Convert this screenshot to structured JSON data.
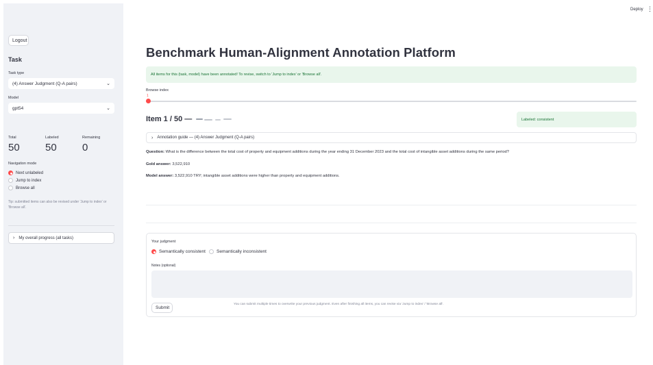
{
  "topbar": {
    "deploy_label": "Deploy",
    "menu_glyph": "⋮"
  },
  "sidebar": {
    "logout_label": "Logout",
    "task_heading": "Task",
    "task_type_label": "Task type",
    "task_type_value": "(4) Answer Judgment (Q-A pairs)",
    "model_label": "Model",
    "model_value": "gpt54",
    "metrics": [
      {
        "label": "Total",
        "value": "50"
      },
      {
        "label": "Labeled",
        "value": "50"
      },
      {
        "label": "Remaining",
        "value": "0"
      }
    ],
    "navigation_label": "Navigation mode",
    "navigation_options": [
      "Next unlabeled",
      "Jump to index",
      "Browse all"
    ],
    "navigation_selected": "Next unlabeled",
    "tip": "Tip: submitted items can also be revised under 'Jump to index' or 'Browse all'.",
    "progress_expander": "My overall progress (all tasks)"
  },
  "main": {
    "title": "Benchmark Human-Alignment Annotation Platform",
    "success_message": "All items for this (task, model) have been annotated! To revise, switch to 'Jump to index' or 'Browse all'.",
    "browse_label": "Browse index",
    "browse_value": 1,
    "browse_value_text": "1",
    "item_title": "Item 1 / 50 —",
    "labeled_status": "Labeled: consistent",
    "guide_label": "Annotation guide — (4) Answer Judgment (Q-A pairs)",
    "question_label": "Question:",
    "question_text": " What is the difference between the total cost of property and equipment additions during the year ending 31 December 2023 and the total cost of intangible asset additions during the same period?",
    "gold_label": "Gold answer:",
    "gold_text": " 3,522,910",
    "model_label": "Model answer:",
    "model_text": " 3,522,910 TRY; intangible asset additions were higher than property and equipment additions.",
    "judgment": {
      "label": "Your judgment",
      "options": [
        "Semantically consistent",
        "Semantically inconsistent"
      ],
      "selected": "Semantically consistent",
      "notes_label": "Notes (optional)",
      "notes_value": "",
      "submit_label": "Submit",
      "submit_hint": "You can submit multiple times to overwrite your previous judgment. Even after finishing all items, you can revise via 'Jump to index' / 'Browse all'."
    }
  },
  "colors": {
    "accent": "#ff4b4b",
    "success_bg": "#e9f6ec",
    "success_text": "#177233",
    "sidebar_bg": "#f0f2f6"
  },
  "icons": {
    "chevron": "chevron-down-icon",
    "expander": "chevron-right-icon",
    "menu": "kebab-menu-icon"
  }
}
